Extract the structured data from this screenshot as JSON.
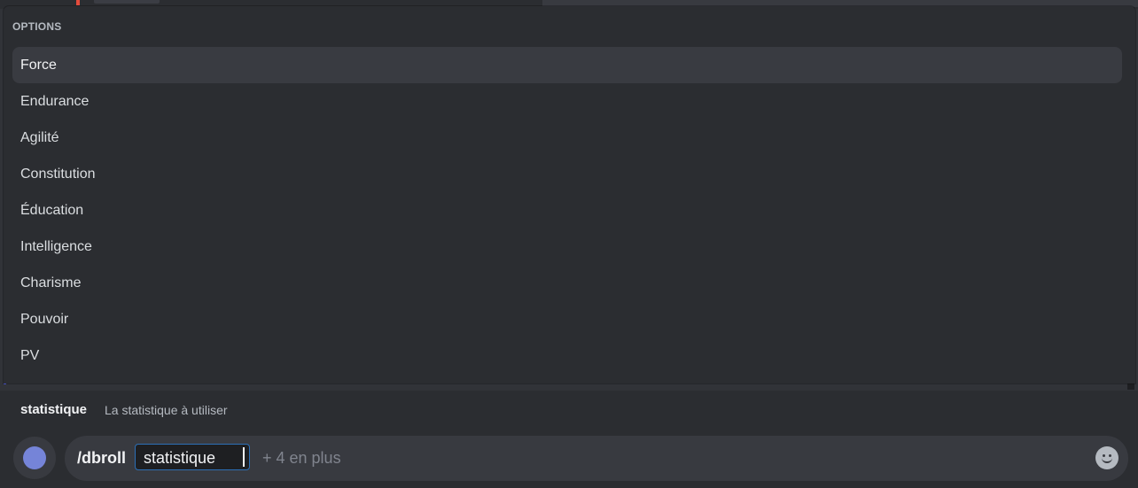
{
  "popup": {
    "header": "OPTIONS",
    "options": [
      {
        "label": "Force",
        "selected": true
      },
      {
        "label": "Endurance",
        "selected": false
      },
      {
        "label": "Agilité",
        "selected": false
      },
      {
        "label": "Constitution",
        "selected": false
      },
      {
        "label": "Éducation",
        "selected": false
      },
      {
        "label": "Intelligence",
        "selected": false
      },
      {
        "label": "Charisme",
        "selected": false
      },
      {
        "label": "Pouvoir",
        "selected": false
      },
      {
        "label": "PV",
        "selected": false
      }
    ]
  },
  "hint": {
    "param_name": "statistique",
    "param_description": "La statistique à utiliser"
  },
  "composer": {
    "command": "/dbroll",
    "active_param": "statistique",
    "more_params": "+ 4 en plus",
    "emoji_icon": "smiley-icon"
  },
  "colors": {
    "background": "#313338",
    "popup": "#2b2d31",
    "selected_option": "#393b41",
    "focus_border": "#2c6fb6"
  }
}
